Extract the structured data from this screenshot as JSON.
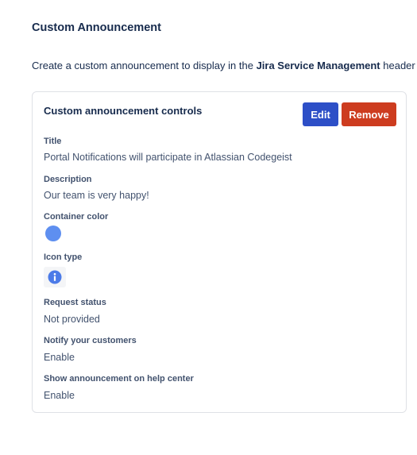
{
  "header": {
    "title": "Custom Announcement",
    "intro_prefix": "Create a custom announcement to display in the ",
    "intro_bold": "Jira Service Management",
    "intro_suffix": " header"
  },
  "card": {
    "title": "Custom announcement controls",
    "edit_label": "Edit",
    "remove_label": "Remove",
    "fields": {
      "title_label": "Title",
      "title_value": "Portal Notifications will participate in Atlassian Codegeist",
      "description_label": "Description",
      "description_value": "Our team is very happy!",
      "container_color_label": "Container color",
      "container_color": "#5e8ff0",
      "icon_type_label": "Icon type",
      "icon_type": "info-icon",
      "request_status_label": "Request status",
      "request_status_value": "Not provided",
      "notify_label": "Notify your customers",
      "notify_value": "Enable",
      "show_label": "Show announcement on help center",
      "show_value": "Enable"
    }
  },
  "colors": {
    "edit_button": "#2d4fc7",
    "remove_button": "#cd3c1f",
    "text_primary": "#172b4d",
    "text_secondary": "#42526e"
  }
}
